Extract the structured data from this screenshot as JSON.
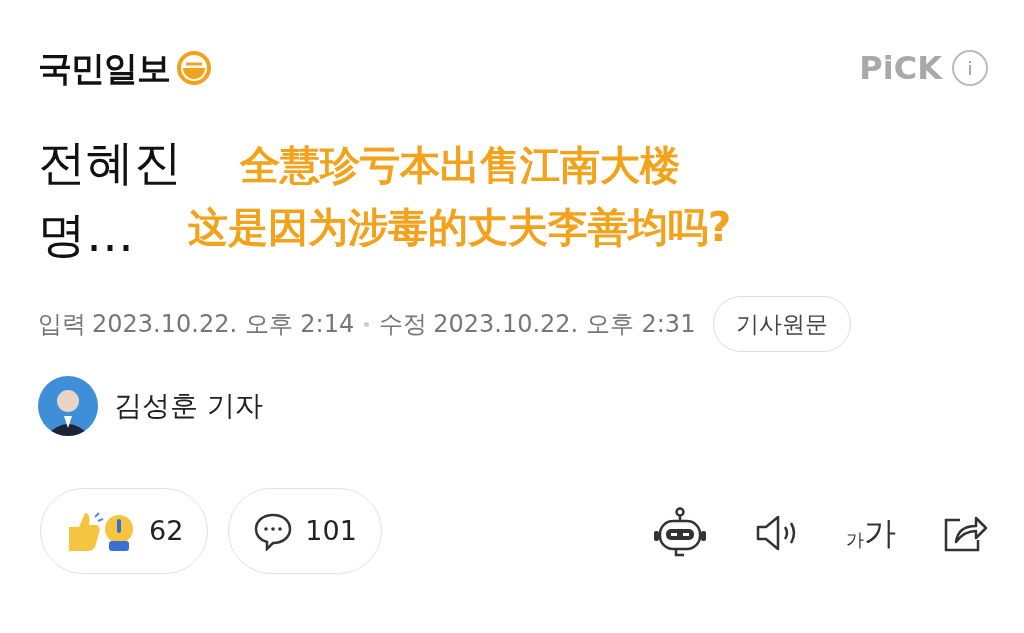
{
  "press": {
    "name": "국민일보"
  },
  "pick": {
    "label": "PiCK",
    "info": "i"
  },
  "title": {
    "lines": [
      "전혜진",
      "명…"
    ]
  },
  "caption": {
    "lines": [
      "全慧珍亏本出售江南大楼",
      "这是因为涉毒的丈夫李善均吗?"
    ]
  },
  "meta": {
    "input_label": "입력",
    "input_time": "2023.10.22. 오후 2:14",
    "edit_label": "수정",
    "edit_time": "2023.10.22. 오후 2:31",
    "original_button": "기사원문"
  },
  "reporter": {
    "name": "김성훈 기자"
  },
  "reactions": {
    "count": "62"
  },
  "comments": {
    "count": "101"
  },
  "font_size_button": {
    "small": "가",
    "large": "가"
  }
}
